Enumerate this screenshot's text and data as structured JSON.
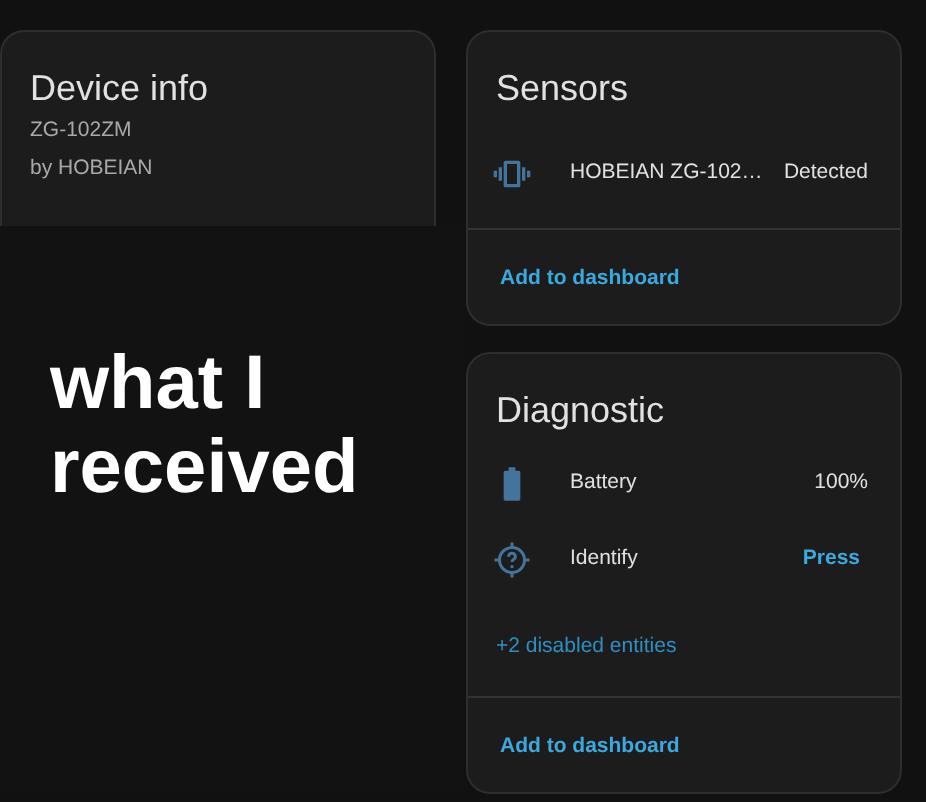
{
  "device_info": {
    "title": "Device info",
    "model": "ZG-102ZM",
    "manufacturer": "by HOBEIAN"
  },
  "annotation": {
    "text": "what I received"
  },
  "sensors": {
    "title": "Sensors",
    "entities": [
      {
        "kind": "binary_sensor",
        "name": "HOBEIAN ZG-102…",
        "state": "Detected"
      }
    ],
    "footer_link": "Add to dashboard"
  },
  "diagnostic": {
    "title": "Diagnostic",
    "entities": [
      {
        "kind": "battery",
        "name": "Battery",
        "state": "100%"
      },
      {
        "kind": "button",
        "name": "Identify",
        "action": "Press"
      }
    ],
    "disabled_link": "+2 disabled entities",
    "footer_link": "Add to dashboard"
  }
}
